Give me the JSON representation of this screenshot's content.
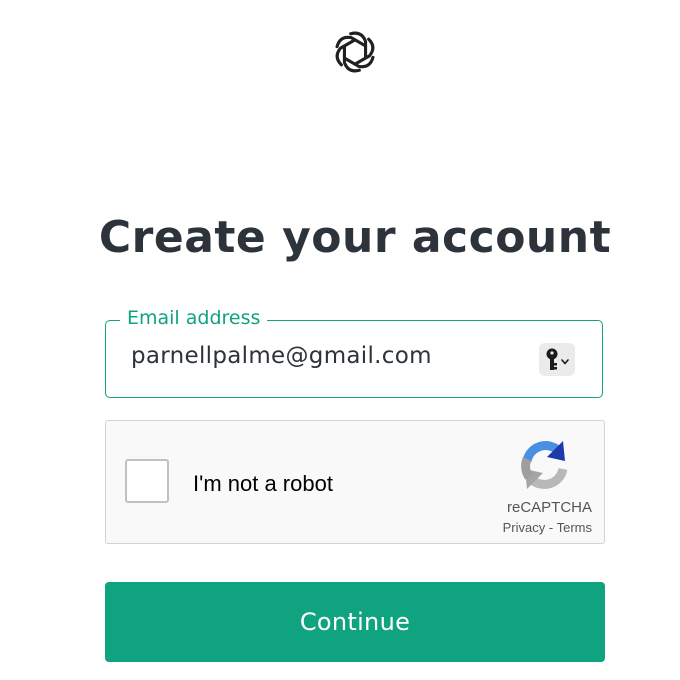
{
  "brand": {
    "logo_icon": "openai-logo-icon",
    "accent_color": "#10a37f",
    "text_color": "#2d333a"
  },
  "heading": {
    "title": "Create your account"
  },
  "email": {
    "label": "Email address",
    "value": "parnellpalme@gmail.com",
    "password_manager_icon": "key-icon"
  },
  "captcha": {
    "checkbox_label": "I'm not a robot",
    "checked": false,
    "brand": "reCAPTCHA",
    "privacy_label": "Privacy",
    "separator": "-",
    "terms_label": "Terms",
    "logo_icon": "recaptcha-logo-icon"
  },
  "actions": {
    "continue_label": "Continue",
    "button_color": "#10a37f"
  }
}
